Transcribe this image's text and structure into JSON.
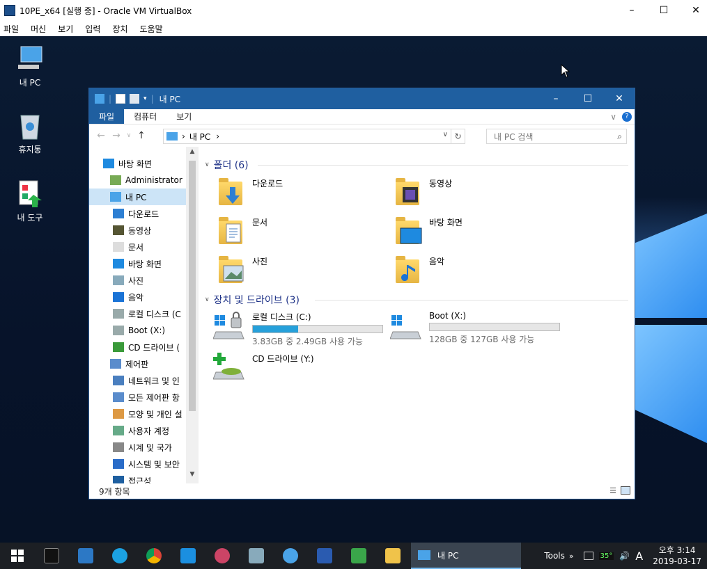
{
  "vbox": {
    "title": "10PE_x64 [실행 중] - Oracle VM VirtualBox",
    "menu": [
      "파일",
      "머신",
      "보기",
      "입력",
      "장치",
      "도움말"
    ]
  },
  "desktop_icons": [
    {
      "label": "내 PC",
      "icon": "computer-icon"
    },
    {
      "label": "휴지통",
      "icon": "recycle-bin-icon"
    },
    {
      "label": "내 도구",
      "icon": "tools-icon"
    }
  ],
  "explorer": {
    "title": "내 PC",
    "ribbon_tabs": [
      "파일",
      "컴퓨터",
      "보기"
    ],
    "address": "내 PC",
    "search_placeholder": "내 PC 검색",
    "nav_items": [
      {
        "label": "바탕 화면",
        "indent": 0,
        "icon": "desktop-icon"
      },
      {
        "label": "Administrator",
        "indent": 1,
        "icon": "user-icon"
      },
      {
        "label": "내 PC",
        "indent": 1,
        "icon": "computer-icon",
        "selected": true
      },
      {
        "label": "다운로드",
        "indent": 2,
        "icon": "download-icon"
      },
      {
        "label": "동영상",
        "indent": 2,
        "icon": "video-icon"
      },
      {
        "label": "문서",
        "indent": 2,
        "icon": "document-icon"
      },
      {
        "label": "바탕 화면",
        "indent": 2,
        "icon": "desktop-icon"
      },
      {
        "label": "사진",
        "indent": 2,
        "icon": "pictures-icon"
      },
      {
        "label": "음악",
        "indent": 2,
        "icon": "music-icon"
      },
      {
        "label": "로컬 디스크 (C",
        "indent": 2,
        "icon": "drive-icon"
      },
      {
        "label": "Boot (X:)",
        "indent": 2,
        "icon": "drive-icon"
      },
      {
        "label": "CD 드라이브 (",
        "indent": 2,
        "icon": "cd-drive-icon"
      },
      {
        "label": "제어판",
        "indent": 1,
        "icon": "control-panel-icon"
      },
      {
        "label": "네트워크 및 인",
        "indent": 2,
        "icon": "network-icon"
      },
      {
        "label": "모든 제어판 항",
        "indent": 2,
        "icon": "control-panel-icon"
      },
      {
        "label": "모양 및 개인 설",
        "indent": 2,
        "icon": "appearance-icon"
      },
      {
        "label": "사용자 계정",
        "indent": 2,
        "icon": "users-icon"
      },
      {
        "label": "시계 및 국가",
        "indent": 2,
        "icon": "clock-icon"
      },
      {
        "label": "시스템 및 보안",
        "indent": 2,
        "icon": "shield-icon"
      },
      {
        "label": "접근성",
        "indent": 2,
        "icon": "accessibility-icon"
      }
    ],
    "folders_header": "폴더 (6)",
    "folders": [
      {
        "label": "다운로드",
        "icon": "download-icon"
      },
      {
        "label": "동영상",
        "icon": "video-icon"
      },
      {
        "label": "문서",
        "icon": "document-icon"
      },
      {
        "label": "바탕 화면",
        "icon": "desktop-icon"
      },
      {
        "label": "사진",
        "icon": "pictures-icon"
      },
      {
        "label": "음악",
        "icon": "music-icon"
      }
    ],
    "devices_header": "장치 및 드라이브 (3)",
    "drives": [
      {
        "label": "로컬 디스크 (C:)",
        "info": "3.83GB 중 2.49GB 사용 가능",
        "used_fraction": 0.35,
        "icon": "windows-drive-icon"
      },
      {
        "label": "Boot (X:)",
        "info": "128GB 중 127GB 사용 가능",
        "used_fraction": 0.0,
        "icon": "windows-drive-icon"
      },
      {
        "label": "CD 드라이브 (Y:)",
        "info": "",
        "icon": "cd-drive-icon"
      }
    ],
    "status": "9개 항목"
  },
  "taskbar": {
    "active_label": "내 PC",
    "tools_label": "Tools",
    "temp": "35°",
    "ime": "A",
    "time": "오후 3:14",
    "date": "2019-03-17"
  },
  "colors": {
    "accent": "#1f5fa0",
    "selection": "#cce4f7",
    "drive_bar": "#26a0da"
  }
}
